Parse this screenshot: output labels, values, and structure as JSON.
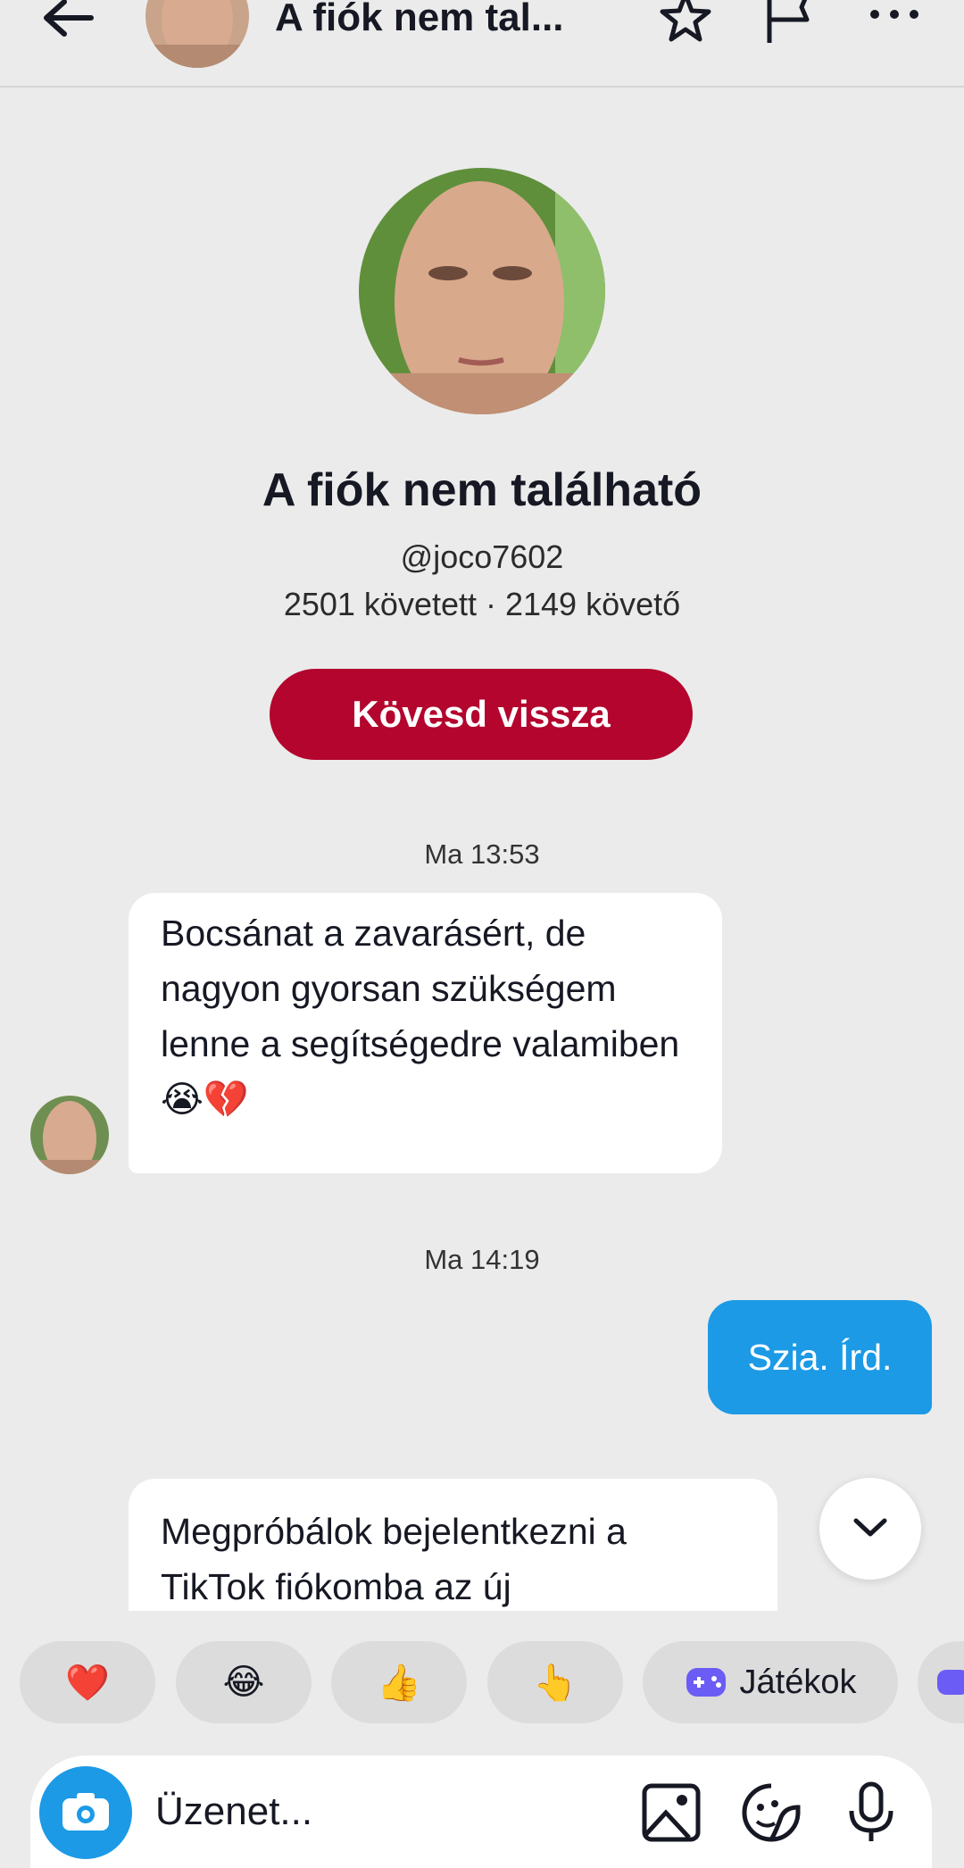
{
  "header": {
    "title": "A fiók nem tal...",
    "back_icon": "arrow-left-icon",
    "star_icon": "star-icon",
    "flag_icon": "flag-icon",
    "more_icon": "more-icon"
  },
  "profile": {
    "name": "A fiók nem található",
    "handle": "@joco7602",
    "stats": "2501 követett · 2149 követő",
    "follow_back_label": "Kövesd vissza"
  },
  "messages": {
    "ts1": "Ma 13:53",
    "msg1_line1": "Bocsánat a zavarásért, de",
    "msg1_line2": "nagyon gyorsan szükségem",
    "msg1_line3": "lenne a segítségedre valamiben",
    "msg1_emoji": "😭💔",
    "ts2": "Ma 14:19",
    "msg2": "Szia. Írd.",
    "msg3_line1": "Megpróbálok bejelentkezni a",
    "msg3_line2": "TikTok fiókomba az új"
  },
  "quick_reactions": {
    "heart": "❤️",
    "laugh": "😂",
    "thumbs_up": "👍",
    "point_up": "👆",
    "games_label": "Játékok"
  },
  "composer": {
    "placeholder": "Üzenet..."
  },
  "colors": {
    "background": "#ebebeb",
    "follow_button": "#b3052d",
    "outgoing_bubble": "#1c9ae6",
    "games_icon": "#6b5cf6"
  }
}
